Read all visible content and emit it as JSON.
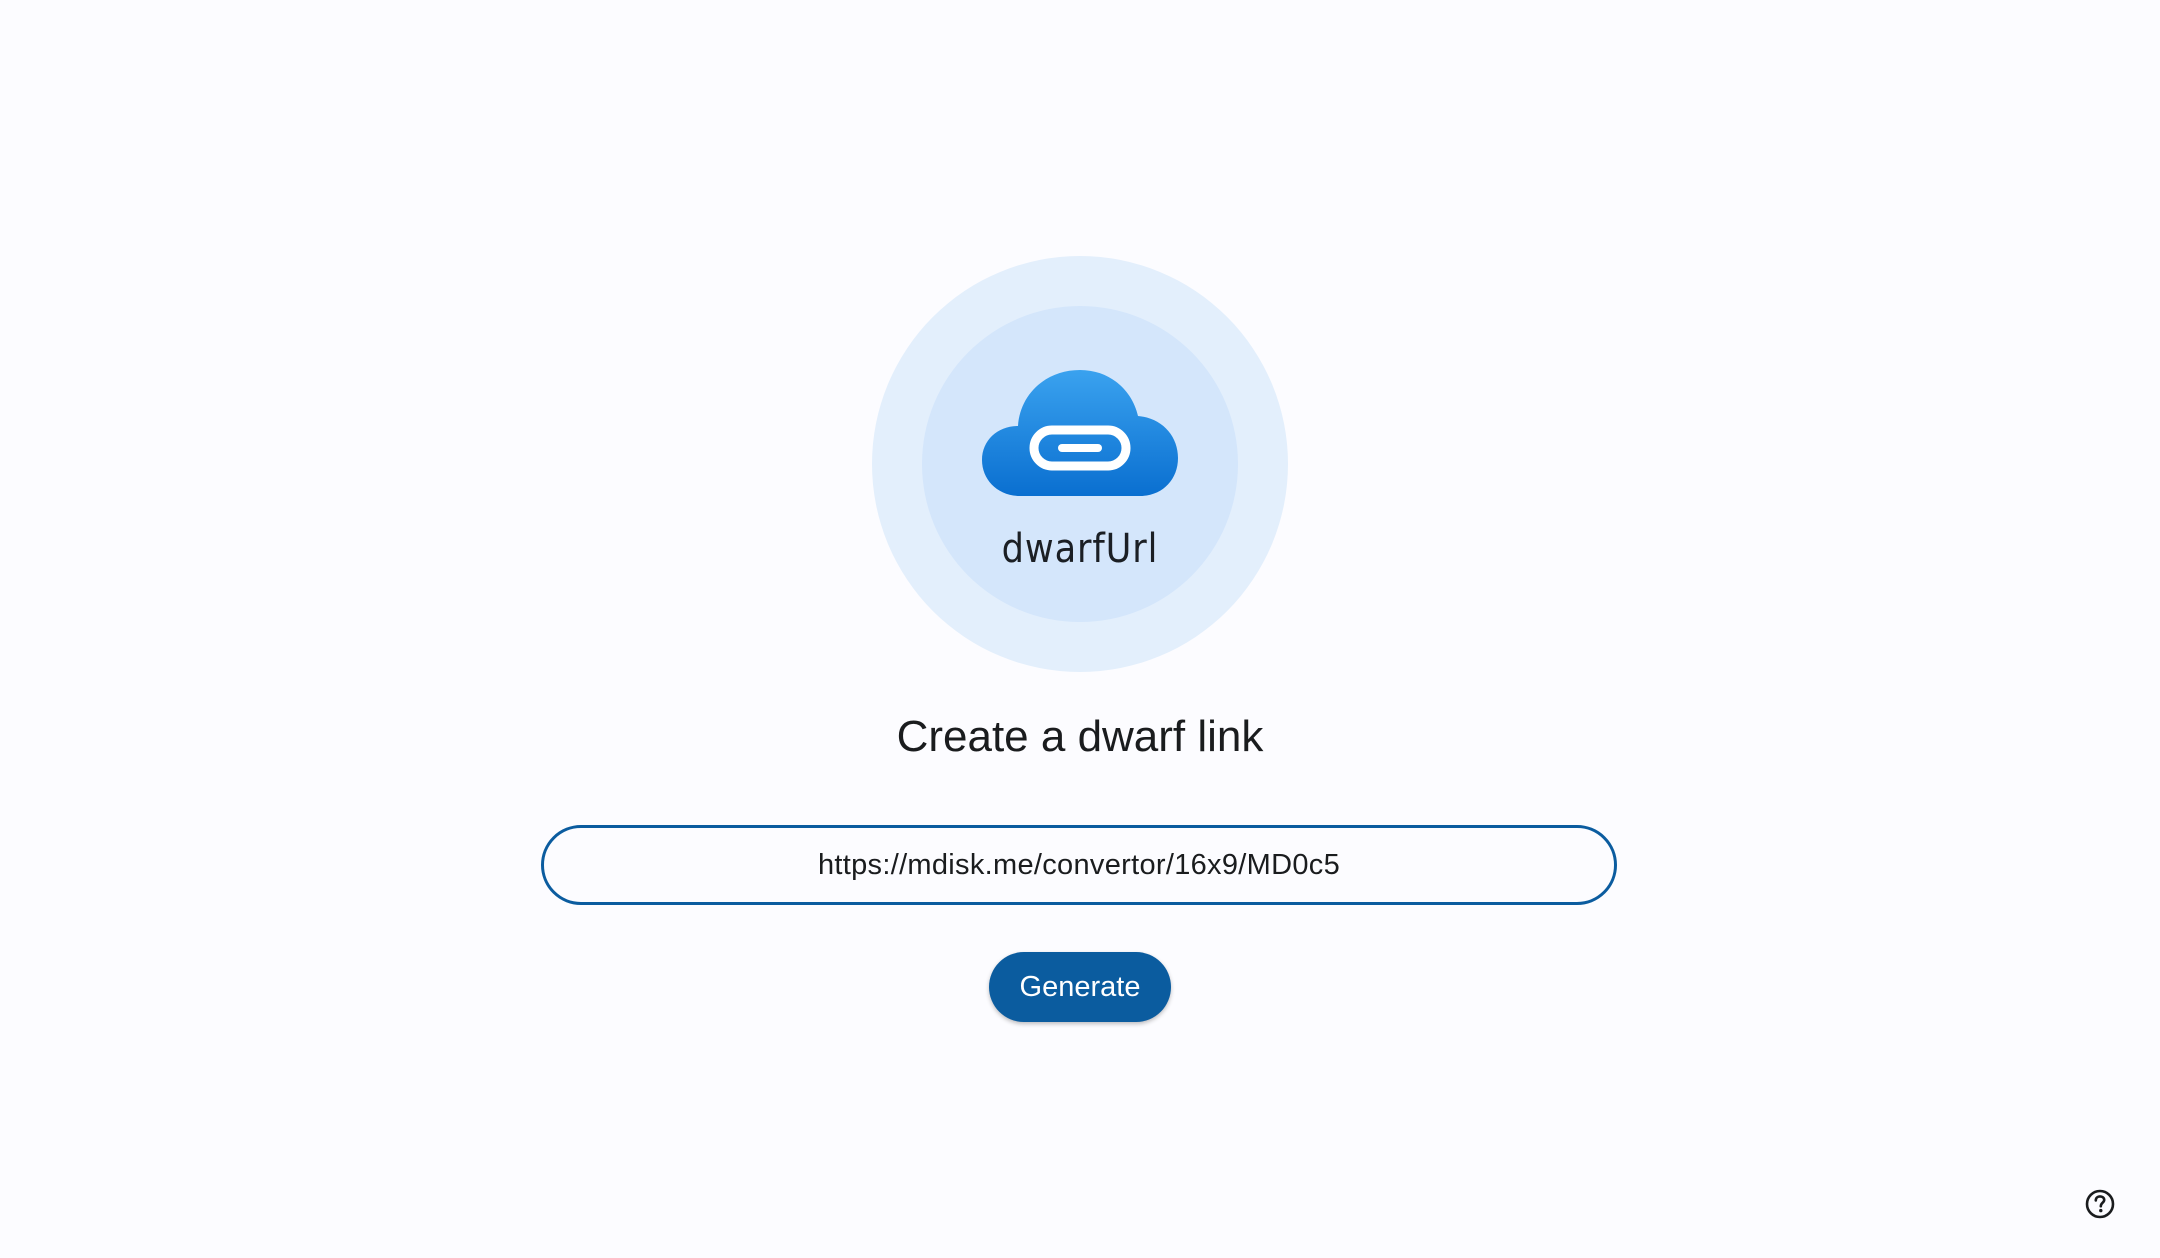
{
  "logo": {
    "name": "dwarfUrl",
    "icon": "cloud-link-icon"
  },
  "main": {
    "title": "Create a dwarf link",
    "url_value": "https://mdisk.me/convertor/16x9/MD0c5",
    "generate_label": "Generate"
  },
  "footer": {
    "help_icon": "help-circle-icon"
  },
  "colors": {
    "primary": "#0b5c9f",
    "background": "#fcfcff",
    "logo_outer": "#e3effc",
    "logo_inner": "#d4e6fb",
    "cloud_top": "#3aa2ef",
    "cloud_bottom": "#0a6fd0"
  }
}
